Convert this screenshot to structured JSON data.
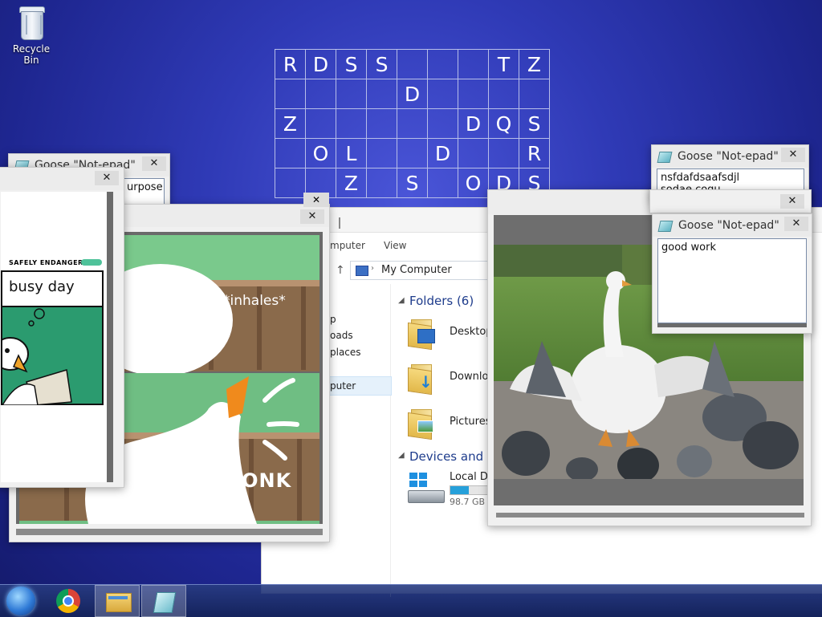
{
  "desktop": {
    "recycle_bin_label": "Recycle Bin",
    "grid_rows": [
      [
        "R",
        "D",
        "S",
        "S",
        "",
        "",
        "",
        "T",
        "Z"
      ],
      [
        "",
        "",
        "",
        "",
        "D",
        "",
        "",
        "",
        ""
      ],
      [
        "Z",
        "",
        "",
        "",
        "",
        "",
        "D",
        "Q",
        "S"
      ],
      [
        "",
        "O",
        "L",
        "",
        "",
        "D",
        "",
        "",
        "R"
      ],
      [
        "",
        "",
        "Z",
        "",
        "S",
        "",
        "O",
        "D",
        "S"
      ]
    ]
  },
  "notepad_left": {
    "title": "Goose \"Not-epad\"",
    "close": "✕",
    "text": "urpose"
  },
  "meme_window": {
    "close": "✕",
    "brand": "SAFELY ENDANGERED",
    "caption": "busy day"
  },
  "comic_window": {
    "close": "✕",
    "inhales": "*inhales*",
    "honk": "HONK"
  },
  "explorer": {
    "menu_view": "View",
    "menu_computer": "mputer",
    "address": "My Computer",
    "nav": [
      "p",
      "oads",
      "places",
      "puter"
    ],
    "folders_header": "Folders (6)",
    "folders": [
      "Desktop",
      "Downloa",
      "Pictures"
    ],
    "devices_header": "Devices and dr",
    "disk_label": "Local Dis",
    "disk_free": "98.7 GB f",
    "disk_fill_percent": 45
  },
  "notepad_right_top": {
    "title": "Goose \"Not-epad\"",
    "close": "✕",
    "line1": "nsfdafdsaafsdjl",
    "line2": "sodae      coqu"
  },
  "image_window": {
    "close": "✕"
  },
  "notepad_right_front": {
    "title": "Goose \"Not-epad\"",
    "close": "✕",
    "text": "good work"
  },
  "taskbar": {
    "items": [
      "start",
      "chrome",
      "explorer",
      "notepad"
    ]
  }
}
